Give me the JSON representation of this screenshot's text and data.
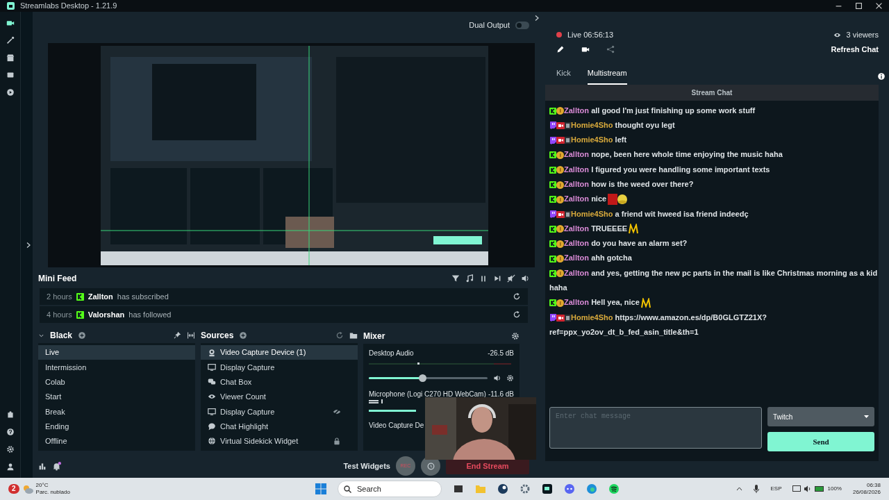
{
  "window": {
    "title": "Streamlabs Desktop - 1.21.9"
  },
  "editor": {
    "dual_output": {
      "label": "Dual Output",
      "on": false
    }
  },
  "mini_feed": {
    "title": "Mini Feed",
    "events": [
      {
        "time": "2 hours",
        "user": "Zallton",
        "action": "has subscribed"
      },
      {
        "time": "4 hours",
        "user": "Valorshan",
        "action": "has followed"
      }
    ]
  },
  "scenes": {
    "title": "Black",
    "items": [
      {
        "label": "Live",
        "selected": true
      },
      {
        "label": "Intermission",
        "selected": false
      },
      {
        "label": "Colab",
        "selected": false
      },
      {
        "label": "Start",
        "selected": false
      },
      {
        "label": "Break",
        "selected": false
      },
      {
        "label": "Ending",
        "selected": false
      },
      {
        "label": "Offline",
        "selected": false
      }
    ]
  },
  "sources": {
    "title": "Sources",
    "items": [
      {
        "label": "Video Capture Device (1)",
        "kind": "webcam",
        "selected": true,
        "hidden": false,
        "locked": false
      },
      {
        "label": "Display Capture",
        "kind": "monitor",
        "selected": false,
        "hidden": false,
        "locked": false
      },
      {
        "label": "Chat Box",
        "kind": "chat",
        "selected": false,
        "hidden": false,
        "locked": false
      },
      {
        "label": "Viewer Count",
        "kind": "eye",
        "selected": false,
        "hidden": false,
        "locked": false
      },
      {
        "label": "Display Capture",
        "kind": "monitor",
        "selected": false,
        "hidden": true,
        "locked": false
      },
      {
        "label": "Chat Highlight",
        "kind": "bubble",
        "selected": false,
        "hidden": false,
        "locked": false
      },
      {
        "label": "Virtual Sidekick Widget",
        "kind": "globe",
        "selected": false,
        "hidden": false,
        "locked": true
      }
    ]
  },
  "mixer": {
    "title": "Mixer",
    "channels": [
      {
        "name": "Desktop Audio",
        "reading": "-26.5 dB",
        "level": 0.45
      },
      {
        "name": "Microphone (Logi C270 HD WebCam)",
        "reading": "-11.6 dB"
      },
      {
        "name": "Video Capture De"
      }
    ]
  },
  "footer": {
    "test_widgets": "Test Widgets",
    "rec": "REC",
    "end_stream": "End Stream"
  },
  "chat": {
    "status": "Live 06:56:13",
    "viewers": "3 viewers",
    "refresh": "Refresh Chat",
    "tabs": [
      {
        "label": "Kick",
        "selected": false
      },
      {
        "label": "Multistream",
        "selected": true
      }
    ],
    "header": "Stream Chat",
    "messages": [
      {
        "kind": "kick",
        "user": "Zallton",
        "color": "#d98ad6",
        "lines": [
          "all good I'm just finishing up some work stuff"
        ]
      },
      {
        "kind": "twitch",
        "user": "Homie4Sho",
        "color": "#d9aa3c",
        "lines": [
          "thought oyu legt"
        ]
      },
      {
        "kind": "twitch",
        "user": "Homie4Sho",
        "color": "#d9aa3c",
        "lines": [
          "left"
        ]
      },
      {
        "kind": "kick",
        "user": "Zallton",
        "color": "#d98ad6",
        "lines": [
          "nope, been here whole time enjoying the music haha"
        ]
      },
      {
        "kind": "kick",
        "user": "Zallton",
        "color": "#d98ad6",
        "lines": [
          "I figured you were handling some important texts"
        ]
      },
      {
        "kind": "kick",
        "user": "Zallton",
        "color": "#d98ad6",
        "lines": [
          "how is the weed over there?"
        ]
      },
      {
        "kind": "kick",
        "user": "Zallton",
        "color": "#d98ad6",
        "lines": [
          "nice"
        ],
        "emotes": [
          {
            "kind": "block"
          },
          {
            "kind": "smiley"
          }
        ]
      },
      {
        "kind": "twitch",
        "user": "Homie4Sho",
        "color": "#d9aa3c",
        "lines": [
          "a friend wit hweed isa friend indeedç"
        ]
      },
      {
        "kind": "kick",
        "user": "Zallton",
        "color": "#d98ad6",
        "lines": [
          "TRUEEEE"
        ],
        "emotes": [
          {
            "kind": "arches"
          }
        ]
      },
      {
        "kind": "kick",
        "user": "Zallton",
        "color": "#d98ad6",
        "lines": [
          "do you have an alarm set?"
        ]
      },
      {
        "kind": "kick",
        "user": "Zallton",
        "color": "#d98ad6",
        "lines": [
          "ahh gotcha"
        ]
      },
      {
        "kind": "kick",
        "user": "Zallton",
        "color": "#d98ad6",
        "lines": [
          "and yes, getting the new pc parts in the mail is like Christmas morning as a kid",
          "haha"
        ]
      },
      {
        "kind": "kick",
        "user": "Zallton",
        "color": "#d98ad6",
        "lines": [
          "Hell yea, nice"
        ],
        "emotes": [
          {
            "kind": "arches"
          }
        ]
      },
      {
        "kind": "twitch",
        "user": "Homie4Sho",
        "color": "#d9aa3c",
        "lines": [
          "https://www.amazon.es/dp/B0GLGTZ21X?",
          "ref=ppx_yo2ov_dt_b_fed_asin_title&th=1"
        ]
      }
    ],
    "input": {
      "placeholder": "Enter chat message"
    },
    "platform_select": "Twitch",
    "send": "Send"
  },
  "taskbar": {
    "weather_badge": "2",
    "temperature": "20°C",
    "weather": "Parc. nublado",
    "search": "Search",
    "language": "ESP",
    "battery": "100%",
    "time": "06:38",
    "date": "26/08/2026"
  }
}
